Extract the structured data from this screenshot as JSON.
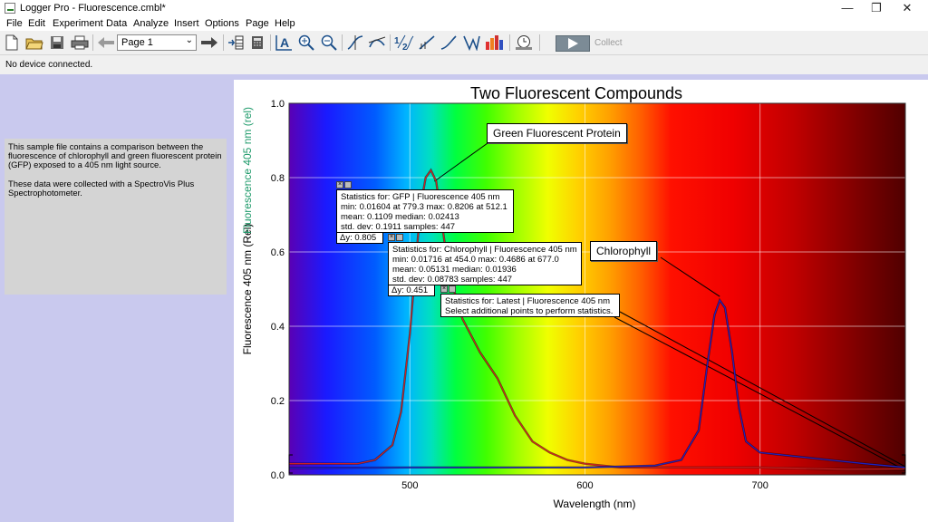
{
  "window": {
    "title": "Logger Pro - Fluorescence.cmbl*",
    "minimize": "—",
    "restore": "❐",
    "close": "✕"
  },
  "menu": [
    "File",
    "Edit",
    "Experiment",
    "Data",
    "Analyze",
    "Insert",
    "Options",
    "Page",
    "Help"
  ],
  "toolbar": {
    "page_select_value": "Page 1",
    "collect_label": "Collect",
    "icons": [
      "new-file-icon",
      "open-folder-icon",
      "save-icon",
      "print-icon",
      "back-arrow-icon",
      "forward-arrow-icon",
      "page-layout-icon",
      "calculator-icon",
      "autoscale-icon",
      "zoom-in-icon",
      "zoom-out-icon",
      "examine-icon",
      "tangent-icon",
      "integral-icon",
      "linear-fit-icon",
      "curve-fit-icon",
      "statistics-icon",
      "histogram-icon",
      "replay-icon",
      "collect-play-icon"
    ]
  },
  "status": {
    "device": "No device connected."
  },
  "description": {
    "p1": "This sample file contains a comparison between the fluorescence of chlorophyll and green fluorescent protein (GFP) exposed to a 405 nm light source.",
    "p2": "These data were collected with a SpectroVis Plus Spectrophotometer."
  },
  "chart_data": {
    "type": "line",
    "title": "Two Fluorescent Compounds",
    "xlabel": "Wavelength (nm)",
    "ylabel_primary": "Fluorescence 405 nm (Rel)",
    "ylabel_secondary": "Fluorescence 405 nm (rel)",
    "xlim": [
      431,
      783
    ],
    "ylim": [
      0.0,
      1.0
    ],
    "xticks": [
      500,
      600,
      700
    ],
    "yticks": [
      0.0,
      0.2,
      0.4,
      0.6,
      0.8,
      1.0
    ],
    "grid": true,
    "background": "visible spectrum gradient",
    "series": [
      {
        "name": "GFP",
        "color": "#d02020",
        "x": [
          431,
          450,
          470,
          480,
          490,
          495,
          500,
          503,
          506,
          509,
          512,
          515,
          520,
          525,
          530,
          540,
          550,
          560,
          570,
          580,
          590,
          600,
          620,
          650,
          700,
          750,
          783
        ],
        "y": [
          0.03,
          0.03,
          0.03,
          0.04,
          0.08,
          0.17,
          0.38,
          0.55,
          0.72,
          0.8,
          0.82,
          0.79,
          0.62,
          0.5,
          0.42,
          0.33,
          0.26,
          0.16,
          0.09,
          0.06,
          0.04,
          0.03,
          0.02,
          0.02,
          0.02,
          0.015,
          0.016
        ]
      },
      {
        "name": "Chlorophyll",
        "color": "#2020c0",
        "x": [
          431,
          460,
          500,
          550,
          600,
          640,
          655,
          665,
          670,
          674,
          677,
          680,
          684,
          688,
          692,
          700,
          720,
          740,
          760,
          783
        ],
        "y": [
          0.018,
          0.019,
          0.02,
          0.02,
          0.02,
          0.025,
          0.04,
          0.12,
          0.3,
          0.43,
          0.47,
          0.45,
          0.33,
          0.18,
          0.09,
          0.06,
          0.05,
          0.04,
          0.03,
          0.02
        ]
      }
    ],
    "callouts": {
      "gfp": "Green Fluorescent Protein",
      "chlorophyll": "Chlorophyll"
    },
    "stats_gfp": {
      "line1": "Statistics for: GFP | Fluorescence 405 nm",
      "line2": "min: 0.01604 at 779.3  max: 0.8206 at 512.1",
      "line3": "mean: 0.1109  median: 0.02413",
      "line4": "std. dev: 0.1911  samples: 447",
      "delta": "Δy: 0.805"
    },
    "stats_chl": {
      "line1": "Statistics for: Chlorophyll | Fluorescence 405 nm",
      "line2": "min: 0.01716 at 454.0  max: 0.4686 at 677.0",
      "line3": "mean: 0.05131  median: 0.01936",
      "line4": "std. dev: 0.08783  samples: 447",
      "delta": "Δy: 0.451"
    },
    "stats_latest": {
      "line1": "Statistics for: Latest | Fluorescence 405 nm",
      "line2": "Select additional points to perform statistics."
    }
  }
}
